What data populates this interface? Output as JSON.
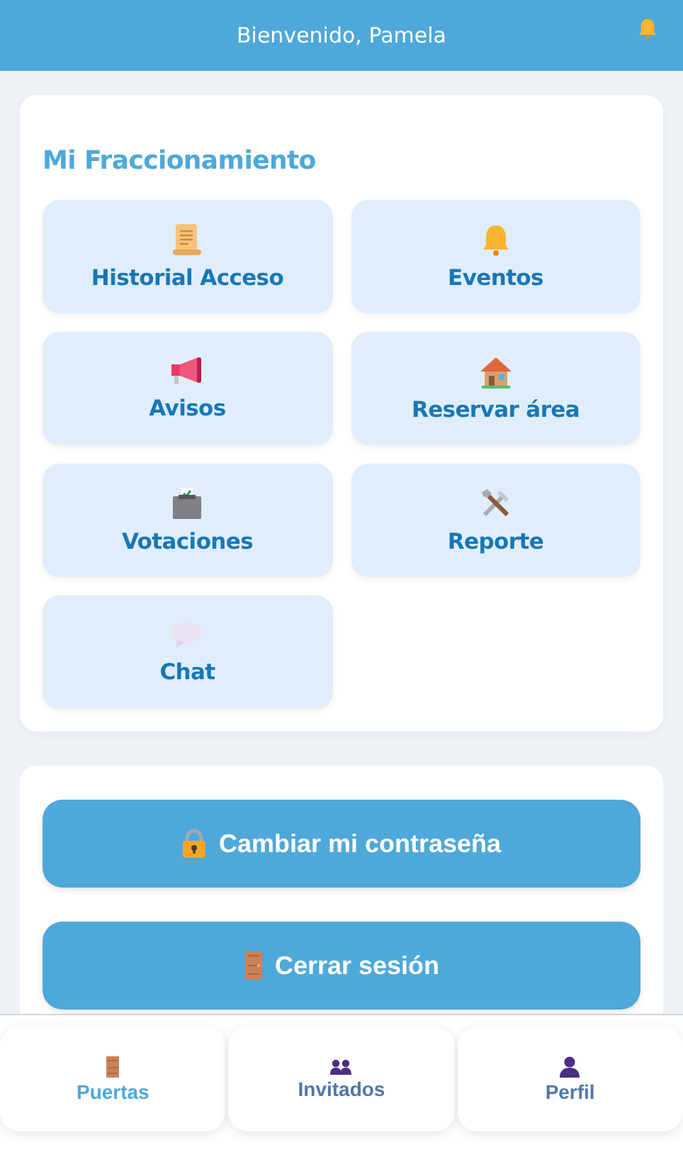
{
  "header": {
    "title": "Bienvenido, Pamela"
  },
  "section": {
    "title": "Mi Fraccionamiento",
    "tiles": [
      {
        "label": "Historial Acceso"
      },
      {
        "label": "Eventos"
      },
      {
        "label": "Avisos"
      },
      {
        "label": "Reservar área"
      },
      {
        "label": "Votaciones"
      },
      {
        "label": "Reporte"
      },
      {
        "label": "Chat"
      }
    ]
  },
  "actions": [
    {
      "label": "Cambiar mi contraseña"
    },
    {
      "label": "Cerrar sesión"
    }
  ],
  "bottom_nav": [
    {
      "label": "Puertas",
      "selected": true
    },
    {
      "label": "Invitados",
      "selected": false
    },
    {
      "label": "Perfil",
      "selected": false
    }
  ]
}
